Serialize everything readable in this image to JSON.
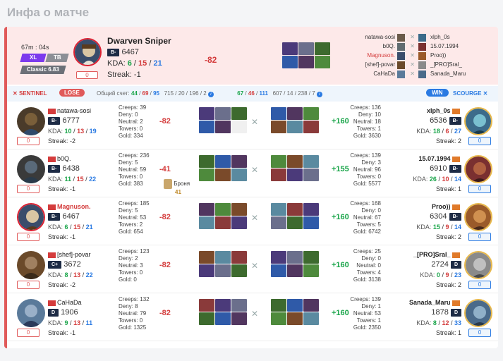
{
  "page_title": "Инфа о матче",
  "header": {
    "duration": "67m : 04s",
    "tags": [
      "XL",
      "TB",
      "Classic 6.83"
    ],
    "hero_name": "Dwarven Sniper",
    "rank": "B-",
    "mmr": "6467",
    "kda_label": "KDA:",
    "kda": [
      "6",
      "15",
      "21"
    ],
    "streak": "Streak: -1",
    "zero": "0",
    "diff": "-82",
    "pairs": [
      {
        "left": "natawa-sosi",
        "right": "xlph_0s"
      },
      {
        "left": "b0Q.",
        "right": "15.07.1994"
      },
      {
        "left": "Magnuson.",
        "right": "Proo))",
        "left_highlight": true
      },
      {
        "left": "[shef]-povar",
        "right": "_[PRO]Sral_"
      },
      {
        "left": "CaHaDa",
        "right": "Sanada_Maru"
      }
    ],
    "vs": "✕"
  },
  "teambar": {
    "sentinel": "SENTINEL",
    "lose": "LOSE",
    "score_label": "Общий счет:",
    "left_score": [
      "44",
      "69",
      "95"
    ],
    "left_totals": "715 / 20 / 196 / 2",
    "right_score": [
      "67",
      "46",
      "111"
    ],
    "right_totals": "607 / 14 / 238 / 7",
    "win": "WIN",
    "scourge": "SCOURGE"
  },
  "labels": {
    "creeps": "Creeps:",
    "deny": "Deny:",
    "neutral": "Neutral:",
    "towers": "Towers:",
    "gold": "Gold:",
    "kda": "KDA:",
    "streak": "Streak:",
    "vs": "✕",
    "zero": "0"
  },
  "rows": [
    {
      "left": {
        "name": "natawa-sosi",
        "rank": "B-",
        "mmr": "6777",
        "kda": [
          "10",
          "13",
          "19"
        ],
        "streak": "-2",
        "creeps": "39",
        "deny": "0",
        "neutral": "2",
        "towers": "0",
        "gold": "334",
        "diff": "-82"
      },
      "right": {
        "name": "xlph_0s",
        "rank": "B-",
        "mmr": "6536",
        "kda": [
          "18",
          "6",
          "27"
        ],
        "streak": "2",
        "creeps": "136",
        "deny": "10",
        "neutral": "18",
        "towers": "1",
        "gold": "3630",
        "diff": "+160"
      }
    },
    {
      "left": {
        "name": "b0Q.",
        "rank": "B-",
        "mmr": "6438",
        "kda": [
          "11",
          "15",
          "22"
        ],
        "streak": "-1",
        "creeps": "236",
        "deny": "5",
        "neutral": "59",
        "towers": "0",
        "gold": "383",
        "diff": "-41",
        "armor_label": "Броня",
        "armor_value": "41"
      },
      "right": {
        "name": "15.07.1994",
        "rank": "B-",
        "mmr": "6910",
        "kda": [
          "26",
          "10",
          "14"
        ],
        "streak": "1",
        "creeps": "139",
        "deny": "3",
        "neutral": "96",
        "towers": "0",
        "gold": "5577",
        "diff": "+155"
      }
    },
    {
      "left": {
        "name": "Magnuson.",
        "rank": "B-",
        "mmr": "6467",
        "kda": [
          "6",
          "15",
          "21"
        ],
        "streak": "-1",
        "creeps": "185",
        "deny": "5",
        "neutral": "53",
        "towers": "2",
        "gold": "654",
        "diff": "-82",
        "highlight": true
      },
      "right": {
        "name": "Proo))",
        "rank": "B-",
        "mmr": "6304",
        "kda": [
          "15",
          "9",
          "14"
        ],
        "streak": "2",
        "creeps": "168",
        "deny": "0",
        "neutral": "67",
        "towers": "5",
        "gold": "6742",
        "diff": "+160"
      }
    },
    {
      "left": {
        "name": "[shef]-povar",
        "rank": "C+",
        "mmr": "3672",
        "kda": [
          "8",
          "13",
          "22"
        ],
        "streak": "-2",
        "creeps": "123",
        "deny": "2",
        "neutral": "3",
        "towers": "0",
        "gold": "0",
        "diff": "-82"
      },
      "right": {
        "name": "_[PRO]Sral_",
        "rank": "D",
        "mmr": "2724",
        "kda": [
          "0",
          "9",
          "23"
        ],
        "streak": "2",
        "creeps": "25",
        "deny": "0",
        "neutral": "0",
        "towers": "4",
        "gold": "3138",
        "diff": "+160"
      }
    },
    {
      "left": {
        "name": "CaHaDa",
        "rank": "D",
        "mmr": "1906",
        "kda": [
          "9",
          "13",
          "11"
        ],
        "streak": "-1",
        "creeps": "132",
        "deny": "8",
        "neutral": "79",
        "towers": "0",
        "gold": "1325",
        "diff": "-82"
      },
      "right": {
        "name": "Sanada_Maru",
        "rank": "D",
        "mmr": "1878",
        "kda": [
          "8",
          "12",
          "33"
        ],
        "streak": "1",
        "creeps": "139",
        "deny": "1",
        "neutral": "53",
        "towers": "1",
        "gold": "2350",
        "diff": "+160"
      }
    }
  ],
  "colors": {
    "kill": "#1aa54a",
    "death": "#d43c3c",
    "assist": "#2a7ae2",
    "sentinel": "#d43c3c",
    "scourge": "#2a7ae2"
  }
}
